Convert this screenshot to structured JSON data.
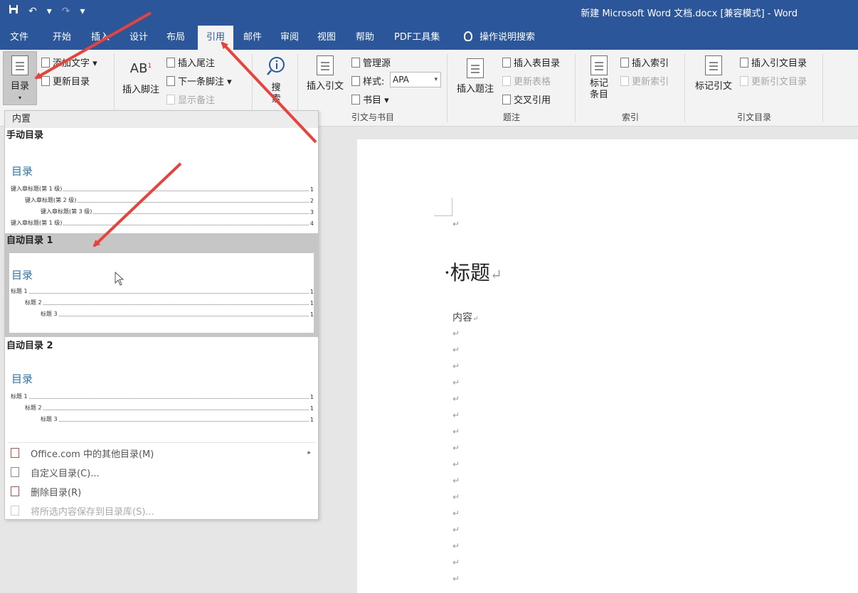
{
  "quick_access": {
    "save_icon": "save-icon",
    "undo_glyph": "↶",
    "redo_glyph": "↷",
    "more": "▾"
  },
  "window": {
    "title": "新建 Microsoft Word 文档.docx [兼容模式] - Word"
  },
  "menu_tabs": [
    "文件",
    "开始",
    "插入",
    "设计",
    "布局",
    "引用",
    "邮件",
    "审阅",
    "视图",
    "帮助",
    "PDF工具集"
  ],
  "tell_me": "操作说明搜索",
  "ribbon": {
    "toc_button": "目录",
    "toc_caret": "▾",
    "add_text": "添加文字 ▾",
    "update_toc": "更新目录",
    "insert_footnote": "插入脚注",
    "ab_icon": "AB",
    "ab_sup": "1",
    "insert_endnote": "插入尾注",
    "next_footnote": "下一条脚注 ▾",
    "show_notes": "显示备注",
    "search": "搜索",
    "insert_citation": "插入引文",
    "manage_sources": "管理源",
    "style_label": "样式:",
    "style_value": "APA",
    "bibliography": "书目 ▾",
    "group_citations": "引文与书目",
    "insert_caption": "插入题注",
    "insert_table_figures": "插入表目录",
    "update_table": "更新表格",
    "cross_ref": "交叉引用",
    "group_captions": "题注",
    "mark_entry": "标记条目",
    "insert_index": "插入索引",
    "update_index": "更新索引",
    "group_index": "索引",
    "mark_citation": "标记引文",
    "insert_toa": "插入引文目录",
    "update_toa": "更新引文目录",
    "group_toa": "引文目录"
  },
  "gallery": {
    "header": "内置",
    "manual": {
      "title": "手动目录",
      "preview_title": "目录",
      "rows": [
        {
          "text": "键入章标题(第 1 级)",
          "page": "1"
        },
        {
          "text": "键入章标题(第 2 级)",
          "page": "2"
        },
        {
          "text": "键入章标题(第 3 级)",
          "page": "3"
        },
        {
          "text": "键入章标题(第 1 级)",
          "page": "4"
        }
      ]
    },
    "auto1": {
      "title": "自动目录 1",
      "preview_title": "目录",
      "rows": [
        {
          "text": "标题 1",
          "page": "1"
        },
        {
          "text": "标题 2",
          "page": "1"
        },
        {
          "text": "标题 3",
          "page": "1"
        }
      ]
    },
    "auto2": {
      "title": "自动目录 2",
      "preview_title": "目录",
      "rows": [
        {
          "text": "标题 1",
          "page": "1"
        },
        {
          "text": "标题 2",
          "page": "1"
        },
        {
          "text": "标题 3",
          "page": "1"
        }
      ]
    },
    "menu": {
      "more": "Office.com 中的其他目录(M)",
      "more_arrow": "▸",
      "custom": "自定义目录(C)...",
      "remove": "删除目录(R)",
      "save": "将所选内容保存到目录库(S)..."
    }
  },
  "document": {
    "para_mark": "↵",
    "heading": "标题",
    "bullet": "·",
    "content": "内容"
  },
  "accent_color": "#2b579a",
  "arrow_color": "#e8423a"
}
